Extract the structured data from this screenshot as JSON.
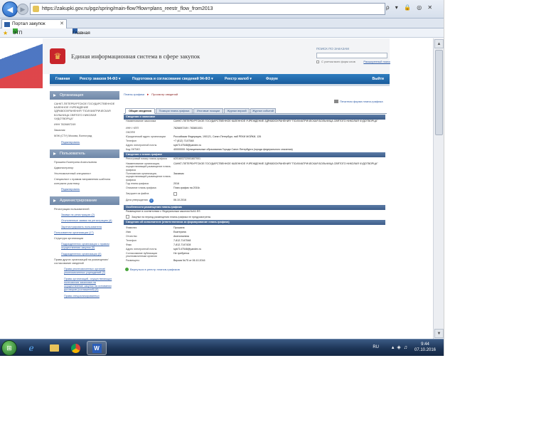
{
  "browser": {
    "url": "https://zakupki.gov.ru/pgz/spring/main-flow?flow=plans_reestr_flow_from2013",
    "url_tools": "ρ ▾ 🔒 ◎ ✕",
    "tab_title": "Портал закупок",
    "favorites": [
      {
        "label": "ЭТП Сбербанк-АСТ (#F2)"
      },
      {
        "label": "Главная Портал Закупок"
      }
    ]
  },
  "header": {
    "site_title": "Единая информационная система в сфере закупок",
    "search_label": "ПОИСК ПО ЗАКАЗАМ",
    "search_placeholder": "",
    "search_option": "С учетом всех форм слов",
    "advanced_search": "Расширенный поиск"
  },
  "menu": {
    "items": [
      "Главная",
      "Реестр заказов 94-ФЗ ▾",
      "Подготовка и согласование сведений 94-ФЗ ▾",
      "Реестр жалоб ▾",
      "Форум"
    ],
    "exit": "Выйти"
  },
  "sidebar": {
    "org": {
      "title": "Организация",
      "name": "САНКТ-ПЕТЕРБУРГСКОЕ ГОСУДАРСТВЕННОЕ КАЗЕННОЕ УЧРЕЖДЕНИЕ ЗДРАВООХРАНЕНИЯ \"ПСИХИАТРИЧЕСКАЯ БОЛЬНИЦА СВЯТОГО НИКОЛАЯ ЧУДОТВОРЦА\"",
      "inn": "ИНН 7826697249",
      "role": "Заказчик",
      "address": "МЭК (СТУ) Москва, Волгоград",
      "edit": "Редактировать"
    },
    "user": {
      "title": "Пользователь",
      "name": "Прошина Екатерина Анатольевна",
      "role1": "Администратор",
      "role2": "Уполномоченный специалист",
      "role3": "Специалист с правом направления шаблона контракта участнику",
      "edit": "Редактировать"
    },
    "admin": {
      "title": "Администрирование",
      "reg_title": "Регистрация пользователей",
      "reg_links": [
        "Заявки на регистрацию (2)",
        "Отклоненные заявки на регистрацию (4)",
        "Зарегистрировать пользователя"
      ],
      "users_link": "Пользователи организации (17)",
      "structure_title": "Структура организации",
      "structure_links": [
        "Подразделения организации с правом осуществления закупок (0)",
        "Подразделения организации (0)"
      ],
      "rights_title": "Права других организаций на размещение/согласование сведений",
      "rights_links": [
        "Права уполномоченных органов/уполномоченных учреждений (2)",
        "Права организаций, осуществляющих полномочия заказчика на осуществление закупок на основании договоров (соглашений) (0)",
        "Права специализированных"
      ]
    }
  },
  "main": {
    "breadcrumb": {
      "parent": "Планы-графики",
      "current": "Просмотр сведений"
    },
    "print_link": "Печатная форма плана-графика",
    "tabs": [
      "Общие сведения",
      "Позиции плана-графика",
      "Итоговые позиции",
      "Журнал версий",
      "Журнал событий"
    ],
    "customer_section": "Сведения о заказчике",
    "customer_rows": [
      {
        "k": "Наименование заказчика",
        "v": "САНКТ-ПЕТЕРБУРГСКОЕ ГОСУДАРСТВЕННОЕ КАЗЕННОЕ УЧРЕЖДЕНИЕ ЗДРАВООХРАНЕНИЯ \"ПСИХИАТРИЧЕСКАЯ БОЛЬНИЦА СВЯТОГО НИКОЛАЯ ЧУДОТВОРЦА\""
      },
      {
        "k": "ИНН / КПП",
        "v": "7826697249 / 783801001"
      },
      {
        "k": "ОКОПФ",
        "v": ""
      },
      {
        "k": "Юридический адрес организации",
        "v": "Российская Федерация, 190121, Санкт-Петербург, наб РЕКИ МОЙКИ, 126"
      },
      {
        "k": "Телефон",
        "v": "+7 (812) 7147548"
      },
      {
        "k": "Адрес электронной почты",
        "v": "spb7147548@yandex.ru"
      },
      {
        "k": "Код ОКТМО",
        "v": "40000000: Муниципальные образования Города Санкт-Петербурга (города федерального значения)"
      }
    ],
    "plan_section": "Сведения о плане-графике",
    "plan_rows": [
      {
        "k": "Реестровый номер плана-графика",
        "v": "#201603722001607001"
      },
      {
        "k": "Наименование организации, осуществляющей размещение плана-графика",
        "v": "САНКТ-ПЕТЕРБУРГСКОЕ ГОСУДАРСТВЕННОЕ КАЗЕННОЕ УЧРЕЖДЕНИЕ ЗДРАВООХРАНЕНИЯ \"ПСИХИАТРИЧЕСКАЯ БОЛЬНИЦА СВЯТОГО НИКОЛАЯ ЧУДОТВОРЦА\""
      },
      {
        "k": "Полномочия организации, осуществляющей размещение плана-графика",
        "v": "Заказчик"
      },
      {
        "k": "Год плана-графика",
        "v": "2016"
      },
      {
        "k": "Описание плана-графика",
        "v": "План-график на 2016г."
      },
      {
        "k": "Загружен из файла",
        "v": ""
      },
      {
        "k": "Дата утверждения",
        "v": "06.10.2016"
      }
    ],
    "feature_section": "Особенности размещения плана-графика",
    "feature_note": "Размещение в соответствии с Федеральным законом №44-ФЗ",
    "feature_check": "Закупки на период размещения плана-графика не предусмотрены",
    "executor_section": "Сведения об исполнителе (ответственном за формирование плана-графика)",
    "executor_rows": [
      {
        "k": "Фамилия",
        "v": "Прошина"
      },
      {
        "k": "Имя",
        "v": "Екатерина"
      },
      {
        "k": "Отчество",
        "v": "Анатольевна"
      },
      {
        "k": "Телефон",
        "v": "7-812-7147548"
      },
      {
        "k": "Факс",
        "v": "7-812-7147428"
      },
      {
        "k": "Адрес электронной почты",
        "v": "spb7147548@yandex.ru"
      },
      {
        "k": "Согласование публикации уполномоченным органом",
        "v": "Не требуется"
      },
      {
        "k": "Размещено",
        "v": "Версия №75 от 06.10.2016"
      }
    ],
    "back_link": "Вернуться в реестр планов-графиков"
  },
  "taskbar": {
    "lang": "RU",
    "time": "9:44",
    "date": "07.10.2016"
  },
  "colors": {
    "menu": "#1f6aa8",
    "section": "#4a6b98",
    "link": "#2b59a6"
  }
}
